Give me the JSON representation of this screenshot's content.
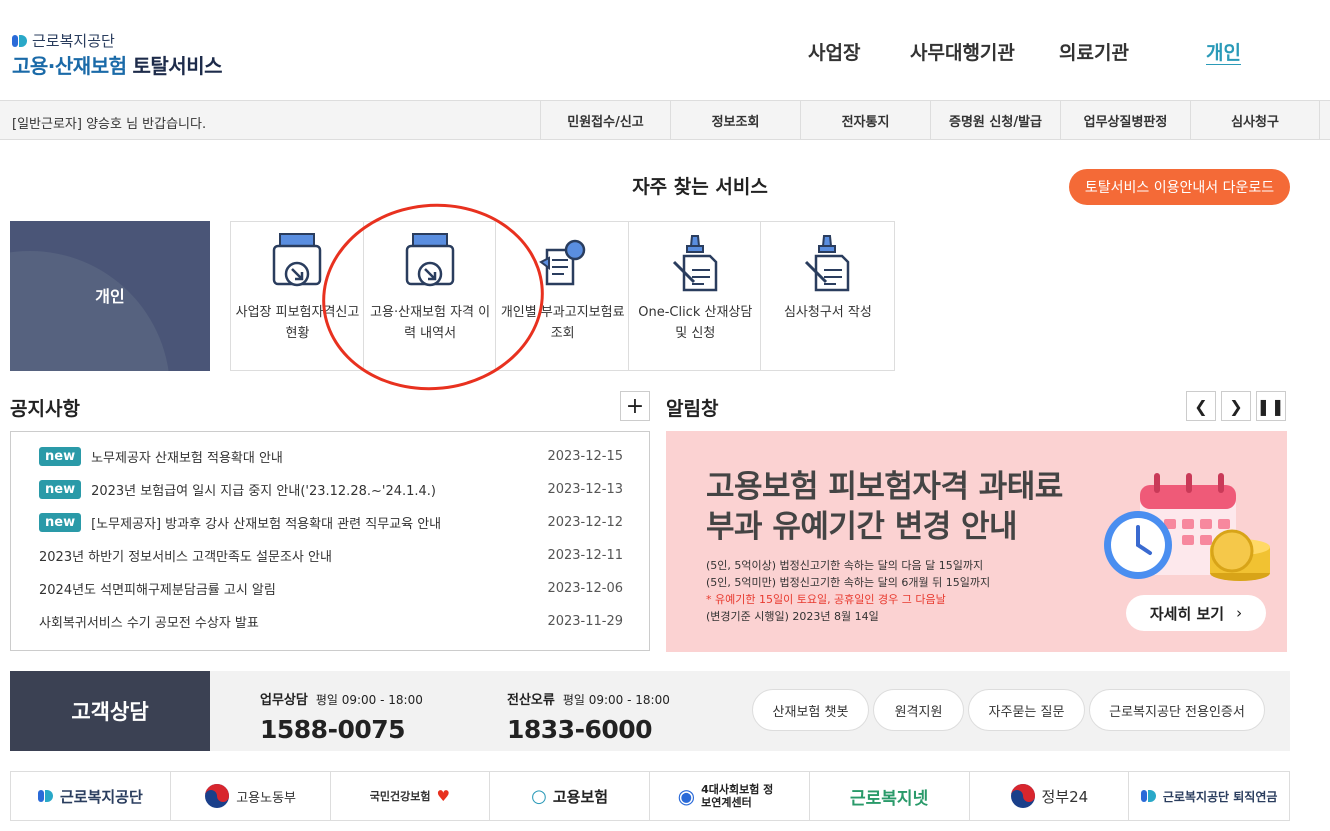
{
  "header": {
    "org_small": "근로복지공단",
    "title_a": "고용·산재보험",
    "title_b": "토탈서비스",
    "nav": [
      "사업장",
      "사무대행기관",
      "의료기관",
      "개인"
    ]
  },
  "subbar": {
    "welcome": "[일반근로자] 양승호 님 반갑습니다.",
    "menu": [
      "민원접수/신고",
      "정보조회",
      "전자통지",
      "증명원 신청/발급",
      "업무상질병판정",
      "심사청구"
    ]
  },
  "services": {
    "title": "자주 찾는 서비스",
    "download": "토탈서비스 이용안내서 다운로드",
    "category": "개인",
    "items": [
      "사업장 피보험자격신고현황",
      "고용·산재보험 자격 이력 내역서",
      "개인별 부과고지보험료 조회",
      "One-Click 산재상담 및 신청",
      "심사청구서 작성"
    ]
  },
  "notice": {
    "title": "공지사항",
    "more": "+",
    "badge": "new",
    "rows": [
      {
        "title": "노무제공자 산재보험 적용확대 안내",
        "date": "2023-12-15",
        "new": true
      },
      {
        "title": "2023년 보험급여 일시 지급 중지 안내('23.12.28.~'24.1.4.)",
        "date": "2023-12-13",
        "new": true
      },
      {
        "title": "[노무제공자] 방과후 강사 산재보험 적용확대 관련 직무교육 안내",
        "date": "2023-12-12",
        "new": true
      },
      {
        "title": "2023년 하반기 정보서비스 고객만족도 설문조사 안내",
        "date": "2023-12-11",
        "new": false
      },
      {
        "title": "2024년도 석면피해구제분담금률 고시 알림",
        "date": "2023-12-06",
        "new": false
      },
      {
        "title": "사회복귀서비스 수기 공모전 수상자 발표",
        "date": "2023-11-29",
        "new": false
      }
    ]
  },
  "alert": {
    "title": "알림창",
    "banner_title_1": "고용보험 피보험자격 과태료",
    "banner_title_2": "부과 유예기간 변경 안내",
    "line1": "(5인, 5억이상) 법정신고기한 속하는 달의 다음 달 15일까지",
    "line2": "(5인, 5억미만) 법정신고기한 속하는 달의 6개월 뒤 15일까지",
    "line3": "* 유예기한 15일이 토요일, 공휴일인 경우 그 다음날",
    "line4": "(변경기준 시행일) 2023년 8월 14일",
    "more": "자세히 보기"
  },
  "consult": {
    "label": "고객상담",
    "work_cap": "업무상담",
    "work_hours": "평일 09:00 - 18:00",
    "work_num": "1588-0075",
    "err_cap": "전산오류",
    "err_hours": "평일 09:00 - 18:00",
    "err_num": "1833-6000",
    "pills": [
      "산재보험 챗봇",
      "원격지원",
      "자주묻는 질문",
      "근로복지공단 전용인증서"
    ]
  },
  "footer": {
    "items": [
      "근로복지공단",
      "고용노동부",
      "국민건강보험",
      "고용보험",
      "4대사회보험 정보연계센터",
      "근로복지넷",
      "정부24",
      "근로복지공단 퇴직연금"
    ]
  },
  "colors": {
    "accent": "#f46a37",
    "teal": "#2a9aa8",
    "banner_bg": "#fbd2d2",
    "dark": "#3b4153"
  }
}
